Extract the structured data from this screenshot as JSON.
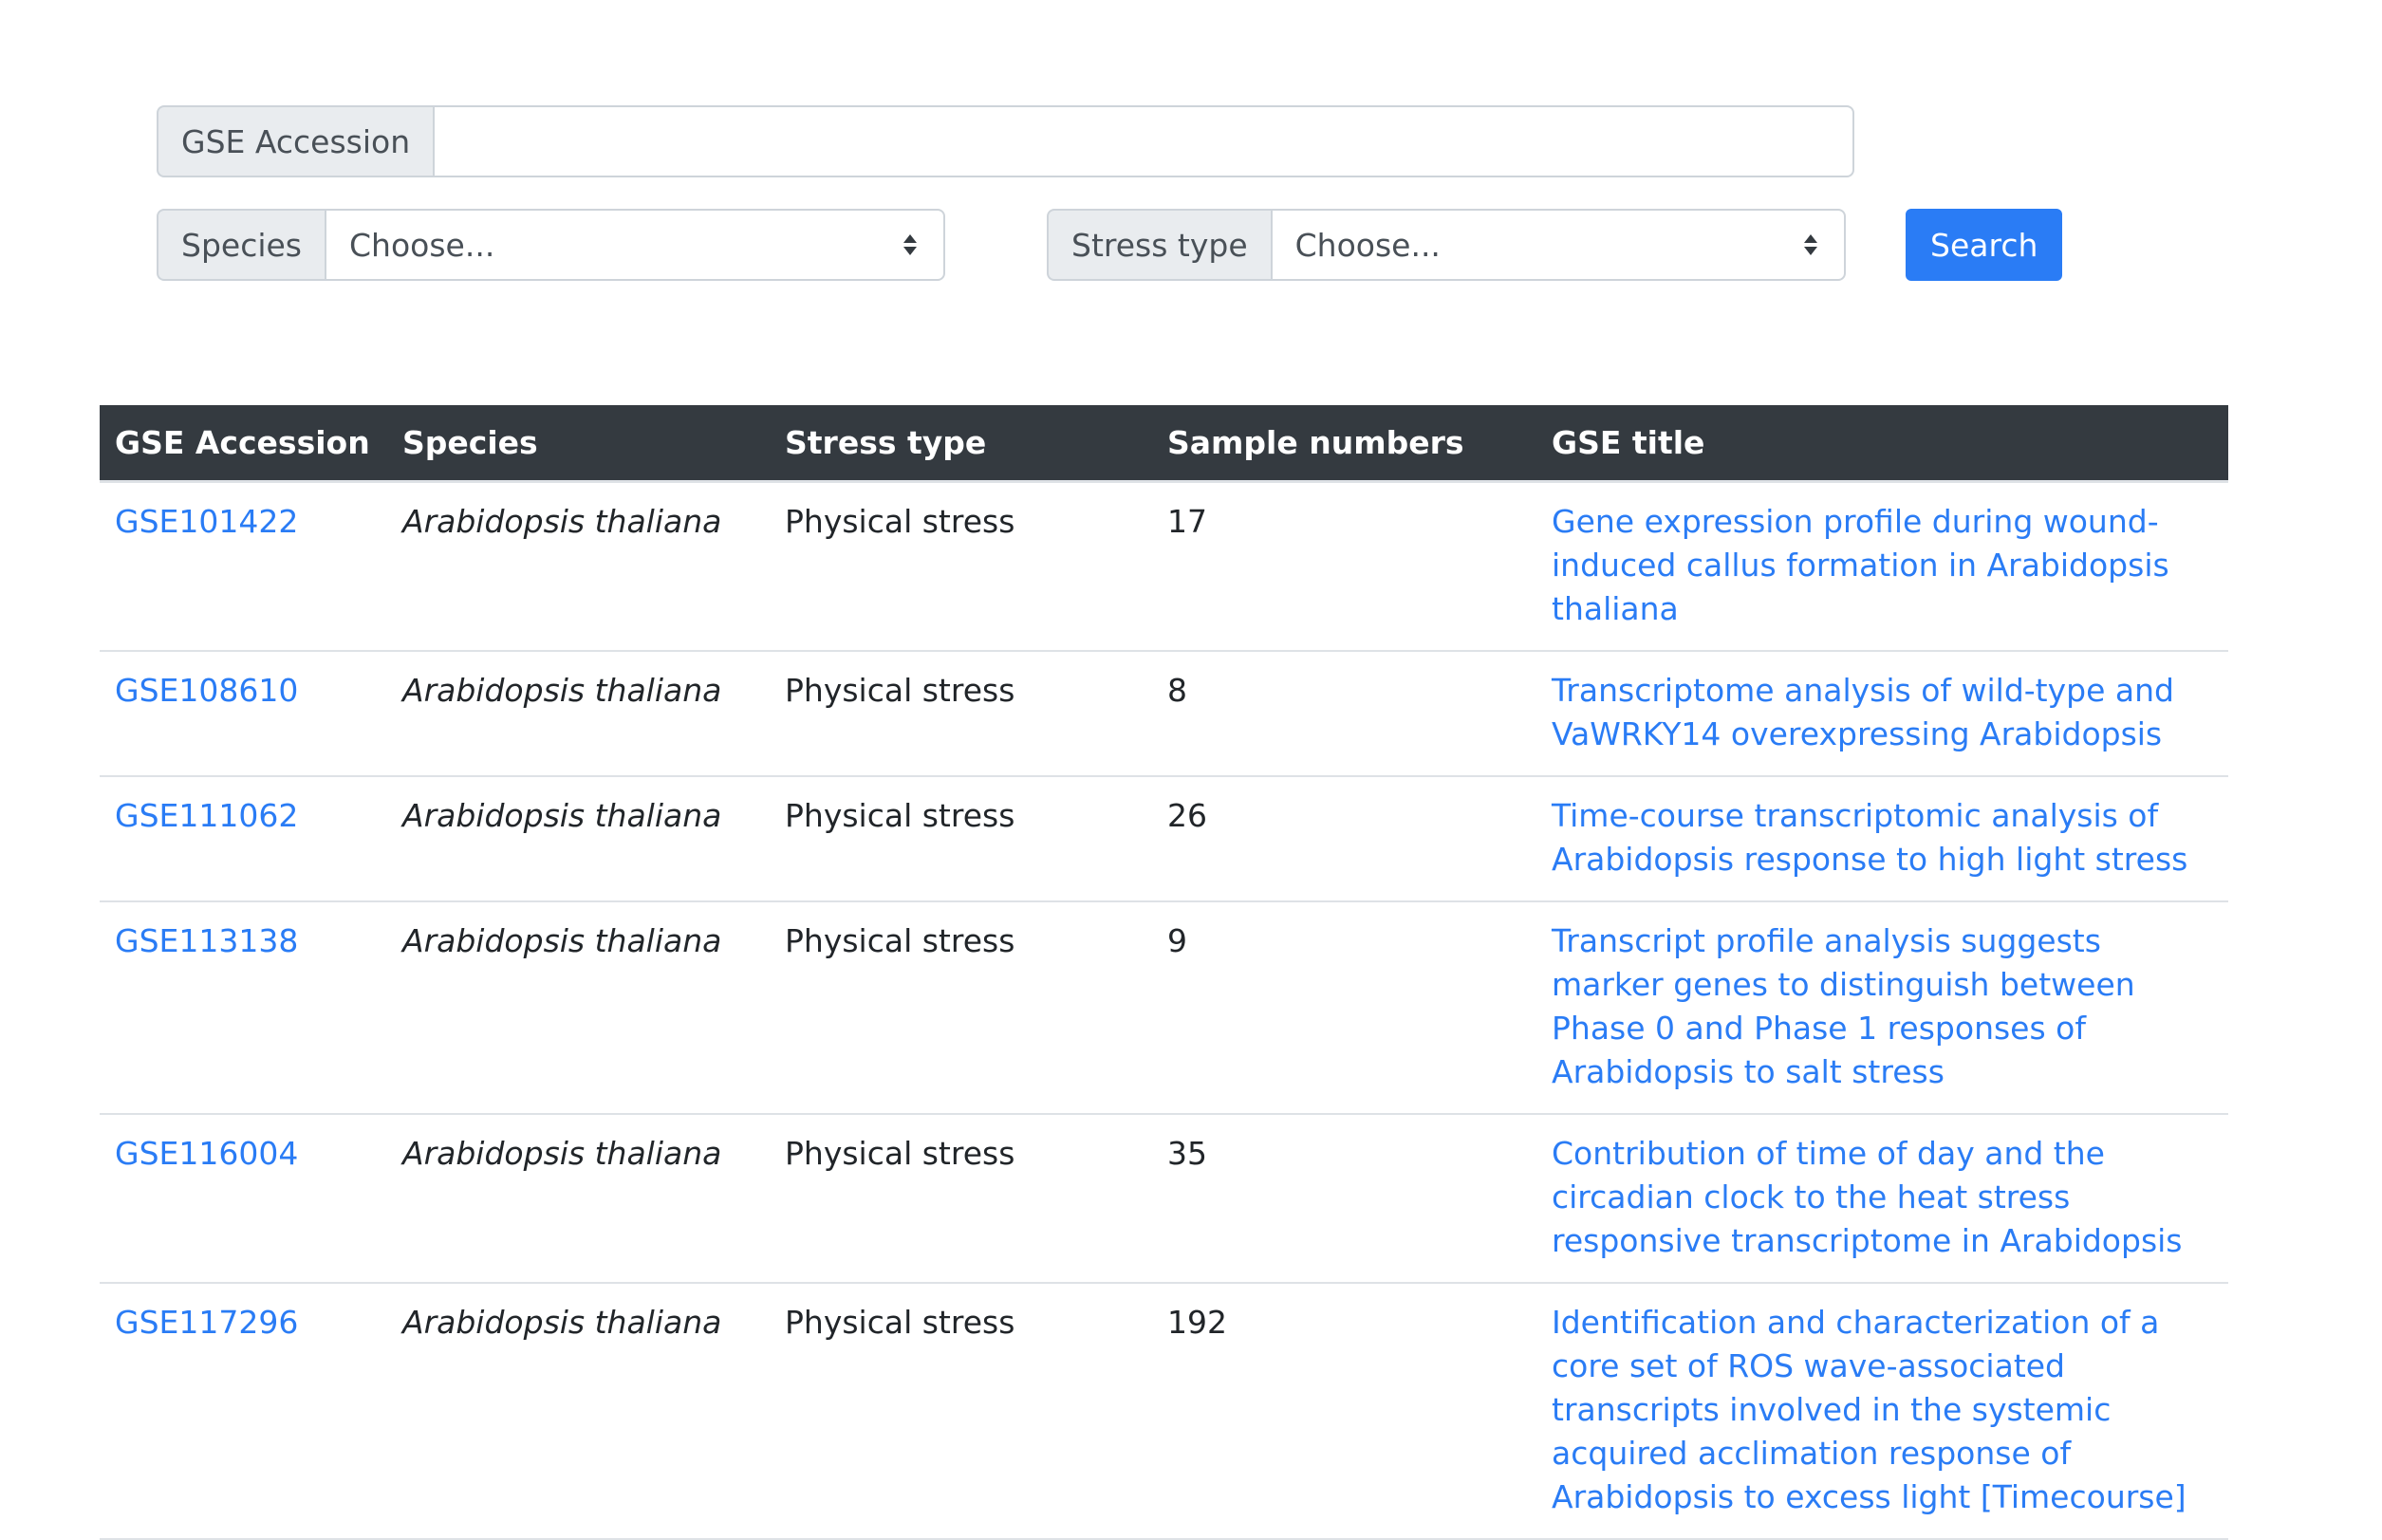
{
  "search": {
    "accession_label": "GSE Accession",
    "accession_value": "",
    "species_label": "Species",
    "species_selected": "Choose...",
    "stress_label": "Stress type",
    "stress_selected": "Choose...",
    "search_button": "Search"
  },
  "table": {
    "headers": [
      "GSE Accession",
      "Species",
      "Stress type",
      "Sample numbers",
      "GSE title"
    ],
    "rows": [
      {
        "accession": "GSE101422",
        "species": "Arabidopsis thaliana",
        "stress": "Physical stress",
        "samples": "17",
        "title": "Gene expression profile during wound-induced callus formation in Arabidopsis thaliana"
      },
      {
        "accession": "GSE108610",
        "species": "Arabidopsis thaliana",
        "stress": "Physical stress",
        "samples": "8",
        "title": "Transcriptome analysis of wild-type and VaWRKY14 overexpressing Arabidopsis"
      },
      {
        "accession": "GSE111062",
        "species": "Arabidopsis thaliana",
        "stress": "Physical stress",
        "samples": "26",
        "title": "Time-course transcriptomic analysis of Arabidopsis response to high light stress"
      },
      {
        "accession": "GSE113138",
        "species": "Arabidopsis thaliana",
        "stress": "Physical stress",
        "samples": "9",
        "title": "Transcript profile analysis suggests marker genes to distinguish between Phase 0 and Phase 1 responses of Arabidopsis to salt stress"
      },
      {
        "accession": "GSE116004",
        "species": "Arabidopsis thaliana",
        "stress": "Physical stress",
        "samples": "35",
        "title": "Contribution of time of day and the circadian clock to the heat stress responsive transcriptome in Arabidopsis"
      },
      {
        "accession": "GSE117296",
        "species": "Arabidopsis thaliana",
        "stress": "Physical stress",
        "samples": "192",
        "title": "Identification and characterization of a core set of ROS wave-associated transcripts involved in the systemic acquired acclimation response of Arabidopsis to excess light [Timecourse]"
      }
    ]
  },
  "colors": {
    "accent": "#2a7cf5",
    "header_bg": "#343a40",
    "addon_bg": "#e9ecef"
  }
}
